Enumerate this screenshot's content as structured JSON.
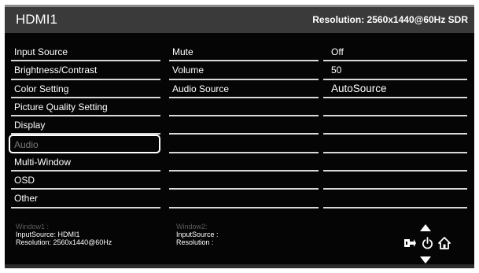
{
  "header": {
    "title": "HDMI1",
    "resolution": "Resolution: 2560x1440@60Hz SDR"
  },
  "menu": {
    "items": [
      "Input Source",
      "Brightness/Contrast",
      "Color Setting",
      "Picture Quality Setting",
      "Display",
      "Audio",
      "Multi-Window",
      "OSD",
      "Other"
    ],
    "selected": "Audio"
  },
  "submenu": {
    "items": [
      "Mute",
      "Volume",
      "Audio Source",
      "",
      "",
      "",
      "",
      "",
      ""
    ]
  },
  "values": {
    "items": [
      "Off",
      "50",
      "AutoSource",
      "",
      "",
      "",
      "",
      "",
      ""
    ]
  },
  "footer": {
    "window1": {
      "title": "Window1 :",
      "input": "InputSource: HDMI1",
      "resolution": "Resolution: 2560x1440@60Hz"
    },
    "window2": {
      "title": "Window2:",
      "input": "InputSource :",
      "resolution": "Resolution :"
    }
  },
  "nav": {
    "icons": [
      "up-arrow-icon",
      "input-switch-icon",
      "power-icon",
      "home-icon",
      "down-arrow-icon"
    ]
  }
}
